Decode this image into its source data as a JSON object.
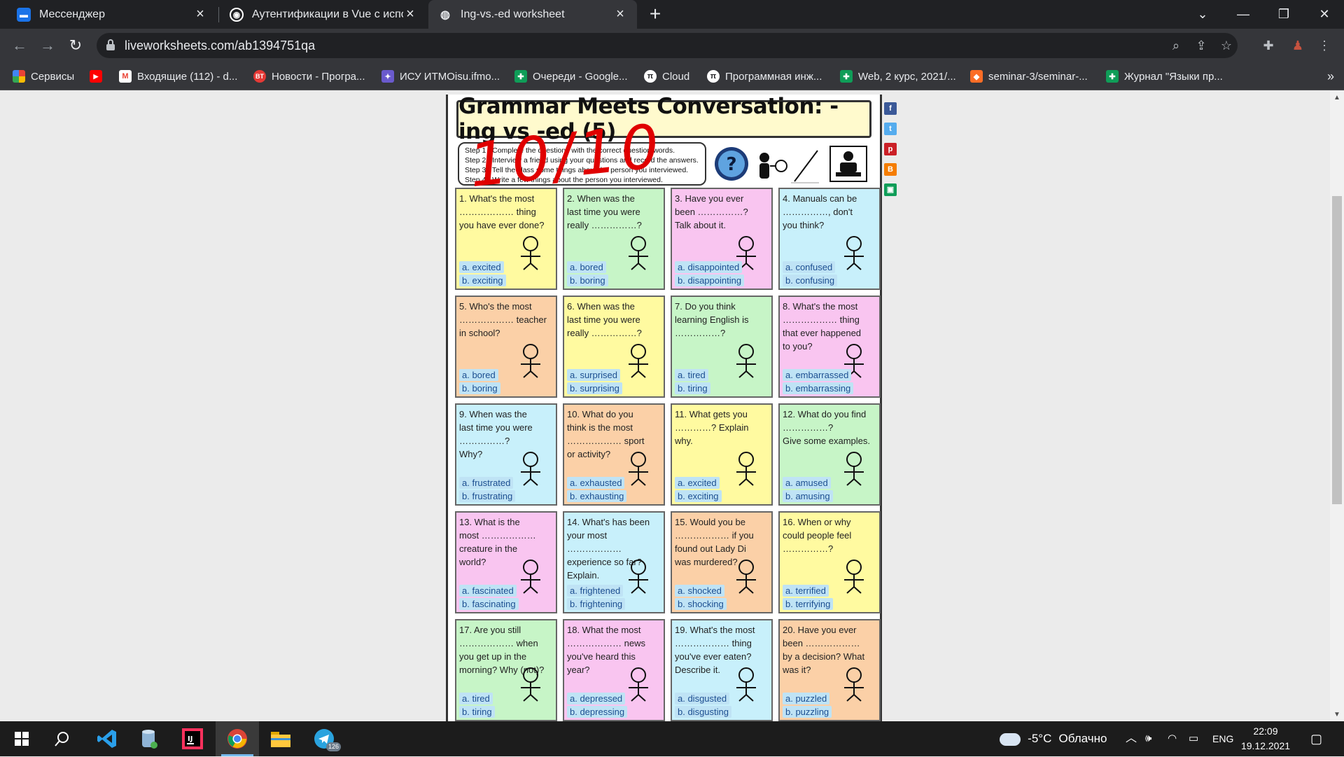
{
  "tabs": [
    {
      "title": "Мессенджер",
      "icon": "messenger-icon",
      "color": "#1a73e8"
    },
    {
      "title": "Аутентификации в Vue с исполь",
      "icon": "vue-hub-icon",
      "color": "#ffffff"
    },
    {
      "title": "Ing-vs.-ed worksheet",
      "icon": "globe-icon",
      "color": "#e8eaed"
    }
  ],
  "toolbar": {
    "url": "liveworksheets.com/ab1394751qa"
  },
  "bookmarks": [
    {
      "label": "Сервисы",
      "icon": "apps-grid-icon",
      "color": "#4285f4"
    },
    {
      "label": "",
      "icon": "youtube-icon",
      "color": "#ff0000"
    },
    {
      "label": "Входящие (112) - d...",
      "icon": "gmail-icon",
      "color": "#ea4335"
    },
    {
      "label": "Новости - Програ...",
      "icon": "bt-icon",
      "color": "#e53935"
    },
    {
      "label": "ИСУ ИТМОisu.ifmo...",
      "icon": "itmo-icon",
      "color": "#6a5acd"
    },
    {
      "label": "Очереди - Google...",
      "icon": "sheets-icon",
      "color": "#0f9d58"
    },
    {
      "label": "Cloud",
      "icon": "pi-icon",
      "color": "#202124"
    },
    {
      "label": "Программная инж...",
      "icon": "pi-icon",
      "color": "#202124"
    },
    {
      "label": "Web, 2 курс, 2021/...",
      "icon": "sheets-icon",
      "color": "#0f9d58"
    },
    {
      "label": "seminar-3/seminar-...",
      "icon": "gitlab-icon",
      "color": "#fc6d26"
    },
    {
      "label": "Журнал \"Языки пр...",
      "icon": "sheets-icon",
      "color": "#0f9d58"
    }
  ],
  "worksheet": {
    "title": "Grammar Meets Conversation: -ing vs -ed (5)",
    "score": "10/10",
    "steps": [
      "Step 1 : Complete the questions with the correct question words.",
      "Step 2 : Interview a friend using your questions and record the answers.",
      "Step 3 : Tell the class some things about the person you interviewed.",
      "Step 4 : Write a few things about the person you interviewed."
    ],
    "cells": [
      {
        "q": "1. What's the most\n……………… thing\nyou have ever done?",
        "a": "a. excited",
        "b": "b. exciting",
        "bg": "#fffaa0",
        "pic": "rollercoaster-icon"
      },
      {
        "q": "2. When was the\nlast time you were\nreally ……………?",
        "a": "a. bored",
        "b": "b. boring",
        "bg": "#c7f5c7",
        "pic": "sleeping-face-icon"
      },
      {
        "q": "3. Have you ever\nbeen ……………?\nTalk about it.",
        "a": "a. disappointed",
        "b": "b. disappointing",
        "bg": "#f9c5f0",
        "pic": "mailbox-icon"
      },
      {
        "q": "4. Manuals can be\n……………, don't\nyou think?",
        "a": "a. confused",
        "b": "b. confusing",
        "bg": "#c8f0fb",
        "pic": "box-icon"
      },
      {
        "q": "5. Who's the most\n……………… teacher\nin school?",
        "a": "a. bored",
        "b": "b. boring",
        "bg": "#fbd0a7",
        "pic": "teacher-icon"
      },
      {
        "q": "6. When was the\nlast time you were\nreally ……………?",
        "a": "a. surprised",
        "b": "b. surprising",
        "bg": "#fffaa0",
        "pic": "gift-icon"
      },
      {
        "q": "7. Do you think\nlearning English is\n……………?",
        "a": "a. tired",
        "b": "b. tiring",
        "bg": "#c7f5c7",
        "pic": "tired-student-icon"
      },
      {
        "q": "8. What's the most\n……………… thing\nthat ever happened\nto you?",
        "a": "a. embarrassed",
        "b": "b. embarrassing",
        "bg": "#f9c5f0",
        "pic": "dress-icon"
      },
      {
        "q": "9. When was the\nlast time you were\n……………?\nWhy?",
        "a": "a. frustrated",
        "b": "b. frustrating",
        "bg": "#c8f0fb",
        "pic": "computer-icon"
      },
      {
        "q": "10. What do you\nthink is the most\n……………… sport\nor activity?",
        "a": "a. exhausted",
        "b": "b. exhausting",
        "bg": "#fbd0a7",
        "pic": "runner-icon"
      },
      {
        "q": "11. What gets you\n…………? Explain\nwhy.",
        "a": "a. excited",
        "b": "b. exciting",
        "bg": "#fffaa0",
        "pic": "megaphone-icon"
      },
      {
        "q": "12. What do you find\n……………?\nGive some examples.",
        "a": "a. amused",
        "b": "b. amusing",
        "bg": "#c7f5c7",
        "pic": "dancer-icon"
      },
      {
        "q": "13. What is the\nmost ………………\ncreature in the\nworld?",
        "a": "a. fascinated",
        "b": "b. fascinating",
        "bg": "#f9c5f0",
        "pic": "octopus-icon"
      },
      {
        "q": "14. What's has been\nyour most ………………\nexperience so far?\nExplain.",
        "a": "a. frightened",
        "b": "b. frightening",
        "bg": "#c8f0fb",
        "pic": "scared-face-icon"
      },
      {
        "q": "15. Would you be\n……………… if you\nfound out Lady Di\nwas murdered?",
        "a": "a. shocked",
        "b": "b. shocking",
        "bg": "#fbd0a7",
        "pic": "shocked-face-icon"
      },
      {
        "q": "16. When or why\ncould people feel\n……………?",
        "a": "a. terrified",
        "b": "b. terrifying",
        "bg": "#fffaa0",
        "pic": "ghost-icon"
      },
      {
        "q": "17. Are you still\n……………… when\nyou get up in the\nmorning? Why (not)?",
        "a": "a. tired",
        "b": "b. tiring",
        "bg": "#c7f5c7",
        "pic": "woman-icon"
      },
      {
        "q": "18. What the most\n……………… news\nyou've heard this\nyear?",
        "a": "a. depressed",
        "b": "b. depressing",
        "bg": "#f9c5f0",
        "pic": "sad-face-icon"
      },
      {
        "q": "19. What's the most\n……………… thing\nyou've ever eaten?\nDescribe it.",
        "a": "a. disgusted",
        "b": "b. disgusting",
        "bg": "#c8f0fb",
        "pic": "plate-icon"
      },
      {
        "q": "20. Have you ever\nbeen ………………\nby a decision? What\nwas it?",
        "a": "a. puzzled",
        "b": "b. puzzling",
        "bg": "#fbd0a7",
        "pic": "puzzled-car-icon"
      }
    ]
  },
  "social": [
    {
      "icon": "facebook-icon",
      "glyph": "f",
      "color": "#3b5998"
    },
    {
      "icon": "twitter-icon",
      "glyph": "t",
      "color": "#55acee"
    },
    {
      "icon": "pinterest-icon",
      "glyph": "p",
      "color": "#cb2027"
    },
    {
      "icon": "blogger-icon",
      "glyph": "B",
      "color": "#f57d00"
    },
    {
      "icon": "google-classroom-icon",
      "glyph": "▣",
      "color": "#0f9d58"
    }
  ],
  "taskbar": {
    "weather_temp": "-5°C",
    "weather_text": "Облачно",
    "lang": "ENG",
    "time": "22:09",
    "date": "19.12.2021",
    "telegram_badge": "126"
  }
}
